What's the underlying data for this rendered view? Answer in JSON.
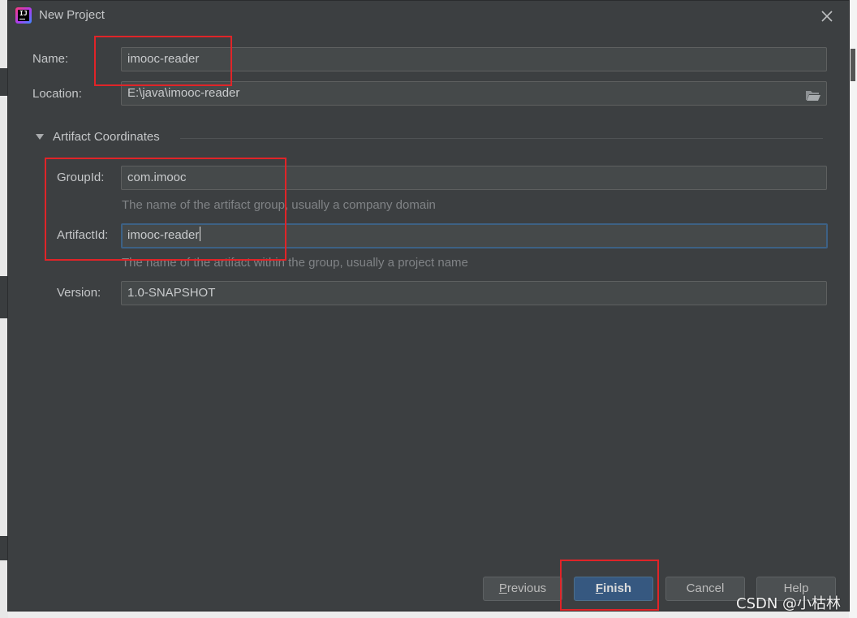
{
  "window": {
    "title": "New Project"
  },
  "form": {
    "name_label": "Name:",
    "name_value": "imooc-reader",
    "location_label": "Location:",
    "location_value": "E:\\java\\imooc-reader",
    "section_title": "Artifact Coordinates",
    "groupid_label": "GroupId:",
    "groupid_value": "com.imooc",
    "groupid_hint": "The name of the artifact group, usually a company domain",
    "artifactid_label": "ArtifactId:",
    "artifactid_value": "imooc-reader",
    "artifactid_hint": "The name of the artifact within the group, usually a project name",
    "version_label": "Version:",
    "version_value": "1.0-SNAPSHOT"
  },
  "buttons": {
    "previous_mnemonic": "P",
    "previous_rest": "revious",
    "finish_mnemonic": "F",
    "finish_rest": "inish",
    "cancel": "Cancel",
    "help": "Help"
  },
  "watermark": "CSDN @小枯林",
  "icons": {
    "app": "intellij-idea-icon",
    "close": "close-icon",
    "folder": "folder-icon",
    "collapse": "triangle-down-icon"
  },
  "colors": {
    "dialog_bg": "#3c3f41",
    "field_bg": "#45494a",
    "primary_button": "#365880",
    "focus_border": "#3d6185",
    "annotation_red": "#e02428"
  }
}
